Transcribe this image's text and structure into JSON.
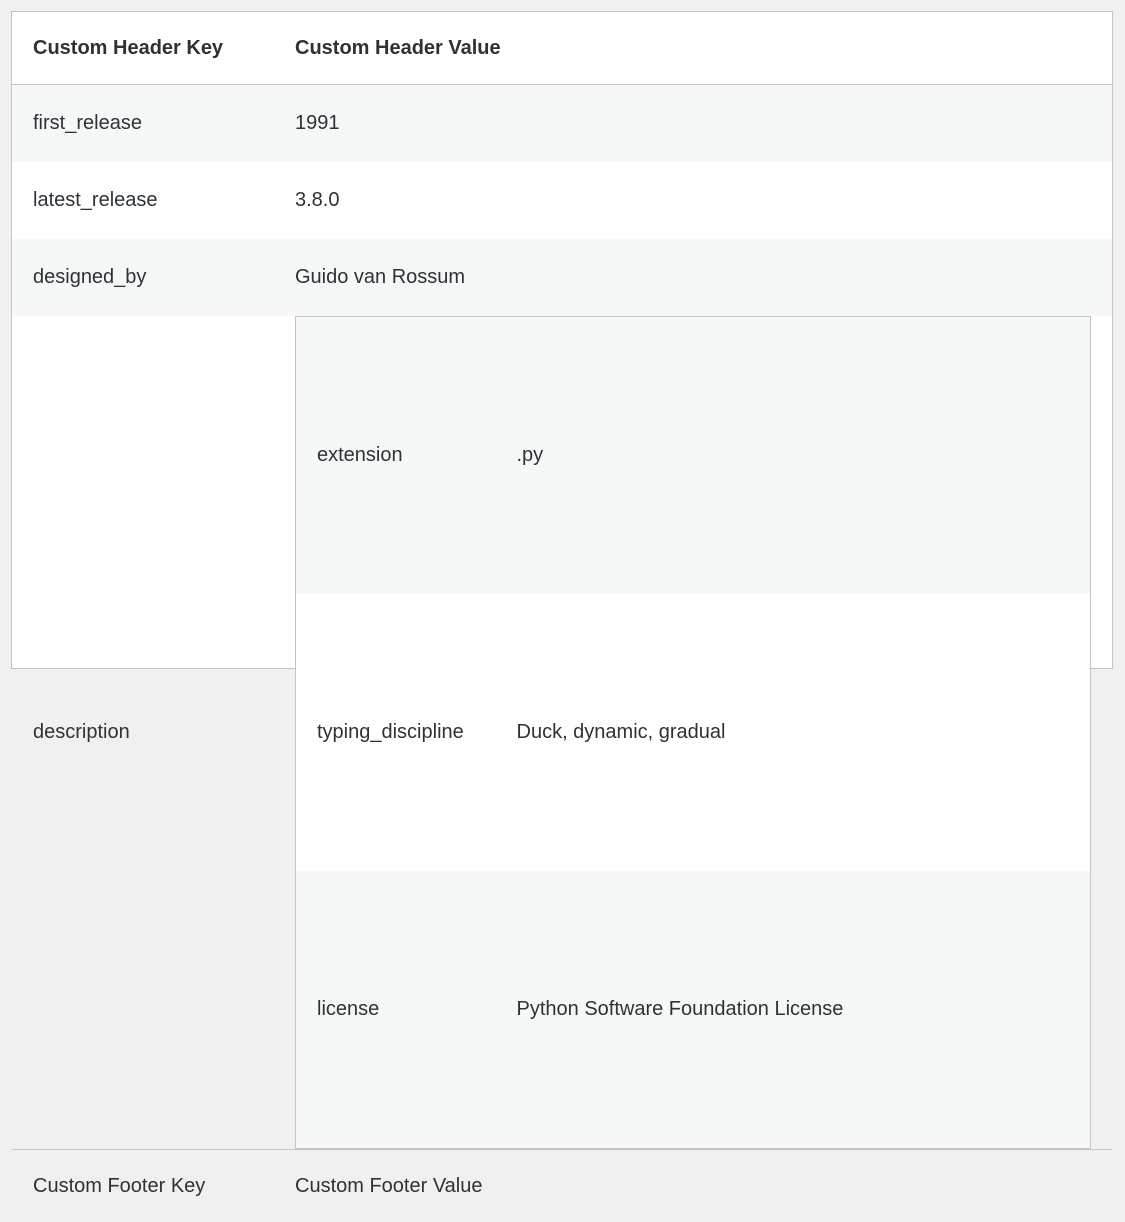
{
  "header": {
    "key_label": "Custom Header Key",
    "value_label": "Custom Header Value"
  },
  "rows": [
    {
      "key": "first_release",
      "value": "1991"
    },
    {
      "key": "latest_release",
      "value": "3.8.0"
    },
    {
      "key": "designed_by",
      "value": "Guido van Rossum"
    },
    {
      "key": "description"
    }
  ],
  "description_table": [
    {
      "key": "extension",
      "value": ".py"
    },
    {
      "key": "typing_discipline",
      "value": "Duck, dynamic, gradual"
    },
    {
      "key": "license",
      "value": "Python Software Foundation License"
    }
  ],
  "footer": {
    "key_label": "Custom Footer Key",
    "value_label": "Custom Footer Value"
  },
  "colors": {
    "stripe": "#f6f7f7",
    "border": "#c3c4c7",
    "text": "#2c3338",
    "background": "#f0f0f1"
  }
}
